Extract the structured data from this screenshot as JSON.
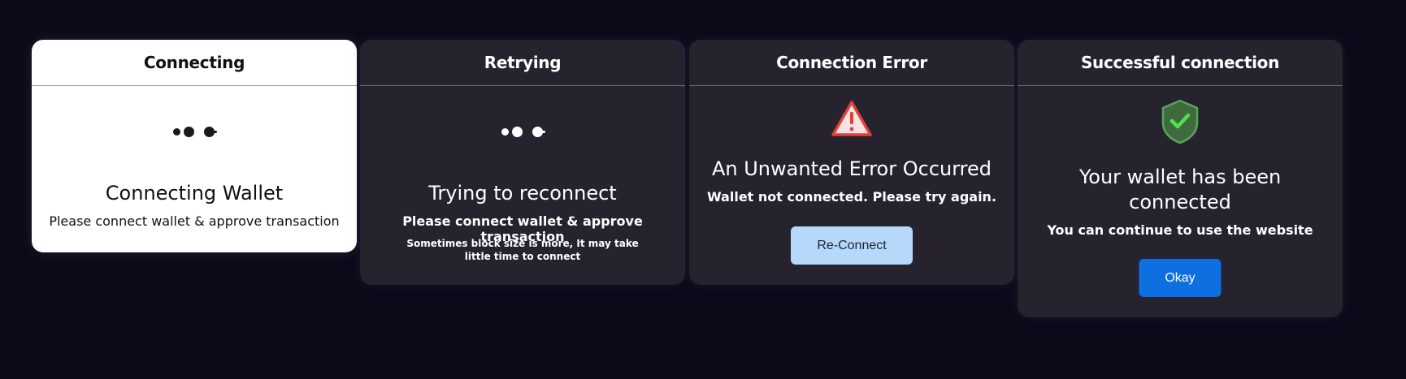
{
  "cards": {
    "connecting": {
      "header": "Connecting",
      "title": "Connecting Wallet",
      "message": "Please connect wallet & approve transaction",
      "icon": "loading-dots-icon"
    },
    "retrying": {
      "header": "Retrying",
      "title": "Trying to reconnect",
      "message": "Please connect wallet & approve transaction",
      "note": "Sometimes block size is more, It may take little time to connect",
      "icon": "loading-dots-icon"
    },
    "error": {
      "header": "Connection Error",
      "title": "An Unwanted Error Occurred",
      "message": "Wallet not connected. Please try again.",
      "button_label": "Re-Connect",
      "icon": "warning-triangle-icon",
      "icon_color": "#e0403a"
    },
    "success": {
      "header": "Successful connection",
      "title": "Your wallet has been connected",
      "message": "You can continue to use the website",
      "button_label": "Okay",
      "icon": "shield-check-icon",
      "icon_color": "#3fcf46"
    }
  },
  "colors": {
    "background": "#0b0a19",
    "card_dark": "#26232f",
    "card_light": "#ffffff",
    "primary_button": "#0d6fe0",
    "secondary_button": "#b6d8fb"
  }
}
